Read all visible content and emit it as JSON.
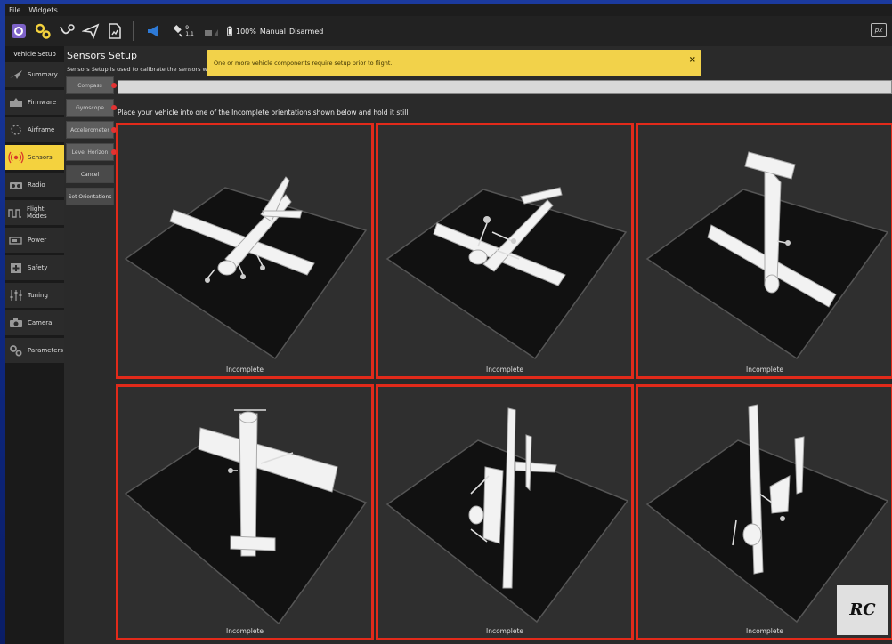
{
  "menu": [
    "File",
    "Widgets"
  ],
  "toolbar": {
    "satellites_count": "9",
    "hdop": "1.1",
    "battery": "100%",
    "flight_mode": "Manual",
    "arm_status": "Disarmed",
    "brand_mark": "px"
  },
  "sidebar": {
    "header": "Vehicle Setup",
    "items": [
      {
        "label": "Summary",
        "icon": "plane-icon",
        "active": false
      },
      {
        "label": "Firmware",
        "icon": "firmware-icon",
        "active": false
      },
      {
        "label": "Airframe",
        "icon": "airframe-icon",
        "active": false
      },
      {
        "label": "Sensors",
        "icon": "sensors-icon",
        "active": true
      },
      {
        "label": "Radio",
        "icon": "radio-icon",
        "active": false
      },
      {
        "label": "Flight Modes",
        "icon": "flight-modes-icon",
        "active": false
      },
      {
        "label": "Power",
        "icon": "power-icon",
        "active": false
      },
      {
        "label": "Safety",
        "icon": "safety-icon",
        "active": false
      },
      {
        "label": "Tuning",
        "icon": "tuning-icon",
        "active": false
      },
      {
        "label": "Camera",
        "icon": "camera-icon",
        "active": false
      },
      {
        "label": "Parameters",
        "icon": "parameters-icon",
        "active": false
      }
    ]
  },
  "main": {
    "title": "Sensors Setup",
    "subtitle": "Sensors Setup is used to calibrate the sensors within",
    "banner": "One or more vehicle components require setup prior to flight.",
    "banner_close": "×",
    "progress": 0.0,
    "instruction": "Place your vehicle into one of the Incomplete orientations shown below and hold it still",
    "sensor_buttons": [
      {
        "label": "Compass",
        "status_dot": true
      },
      {
        "label": "Gyroscope",
        "status_dot": true
      },
      {
        "label": "Accelerometer",
        "status_dot": true
      },
      {
        "label": "Level Horizon",
        "status_dot": true
      },
      {
        "label": "Cancel",
        "status_dot": false
      },
      {
        "label": "Set Orientations",
        "status_dot": false
      }
    ],
    "orientations": [
      {
        "status": "Incomplete"
      },
      {
        "status": "Incomplete"
      },
      {
        "status": "Incomplete"
      },
      {
        "status": "Incomplete"
      },
      {
        "status": "Incomplete"
      },
      {
        "status": "Incomplete"
      }
    ]
  },
  "colors": {
    "accent_yellow": "#f4d23e",
    "incomplete_border": "#e22a1a",
    "status_dot": "#e33232",
    "frame_blue": "#1b3a9e"
  },
  "watermark_text": "RC"
}
